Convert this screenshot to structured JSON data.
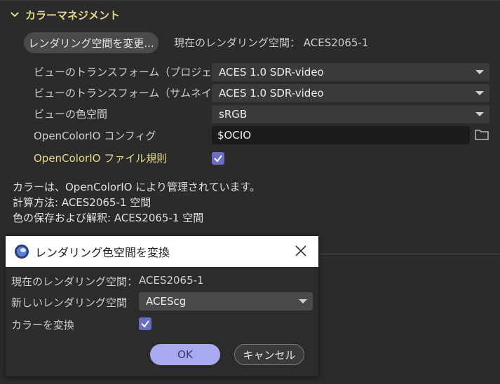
{
  "section": {
    "title": "カラーマネジメント"
  },
  "render_space": {
    "change_button_label": "レンダリング空間を変更...",
    "current_label": "現在のレンダリング空間： ACES2065-1"
  },
  "settings": {
    "view_transform_project_label": "ビューのトランスフォーム（プロジェクト）",
    "view_transform_project_value": "ACES 1.0 SDR-video",
    "view_transform_thumb_label": "ビューのトランスフォーム（サムネイル）",
    "view_transform_thumb_value": "ACES 1.0 SDR-video",
    "view_colorspace_label": "ビューの色空間",
    "view_colorspace_value": "sRGB",
    "ocio_config_label": "OpenColorIO コンフィグ",
    "ocio_config_value": "$OCIO",
    "ocio_file_rules_label": "OpenColorIO ファイル規則",
    "ocio_file_rules_checked": true
  },
  "info": {
    "line1": "カラーは、OpenColorIO により管理されています。",
    "line2": "計算方法: ACES2065-1 空間",
    "line3": "色の保存および解釈: ACES2065-1 空間"
  },
  "dialog": {
    "title": "レンダリング色空間を変換",
    "current_label": "現在のレンダリング空間：",
    "current_value": "ACES2065-1",
    "new_label": "新しいレンダリング空間",
    "new_value": "ACEScg",
    "convert_label": "カラーを変換",
    "convert_checked": true,
    "ok_label": "OK",
    "cancel_label": "キャンセル"
  },
  "colors": {
    "accent": "#6a6ec4",
    "header_yellow": "#e6d88a",
    "ok_button": "#a9a9f2"
  }
}
